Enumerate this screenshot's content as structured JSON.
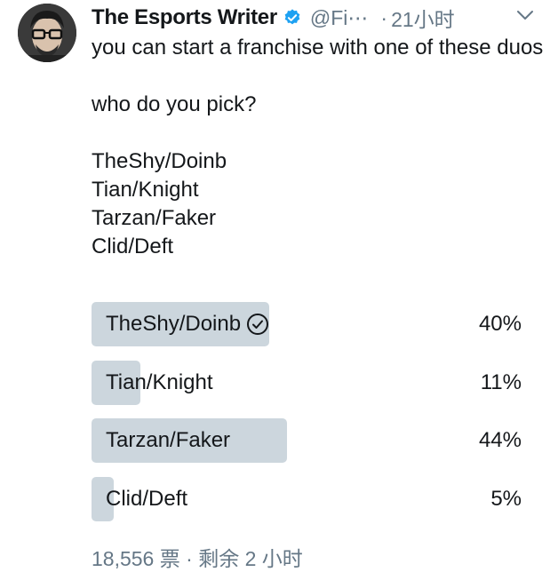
{
  "author": {
    "name": "The Esports Writer",
    "handle": "@Fi⋯",
    "separator": "·",
    "time": "21小时"
  },
  "icons": {
    "avatar": "avatar-photo",
    "verified": "verified-badge-icon",
    "menu": "chevron-down-icon",
    "winner": "check-circle-icon"
  },
  "colors": {
    "bar": "#ccd6dd",
    "verified": "#1da1f2",
    "muted": "#657786"
  },
  "tweet": {
    "lines": [
      "you can start a franchise with one of these duos",
      "who do you pick?",
      "TheShy/Doinb",
      "Tian/Knight",
      "Tarzan/Faker",
      "Clid/Deft"
    ]
  },
  "poll": {
    "options": [
      {
        "label": "TheShy/Doinb",
        "percent_text": "40%",
        "percent": 40,
        "winner": true
      },
      {
        "label": "Tian/Knight",
        "percent_text": "11%",
        "percent": 11,
        "winner": false
      },
      {
        "label": "Tarzan/Faker",
        "percent_text": "44%",
        "percent": 44,
        "winner": false
      },
      {
        "label": "Clid/Deft",
        "percent_text": "5%",
        "percent": 5,
        "winner": false
      }
    ],
    "footer": {
      "votes": "18,556 票",
      "separator": "·",
      "remaining": "剩余 2 小时"
    }
  }
}
